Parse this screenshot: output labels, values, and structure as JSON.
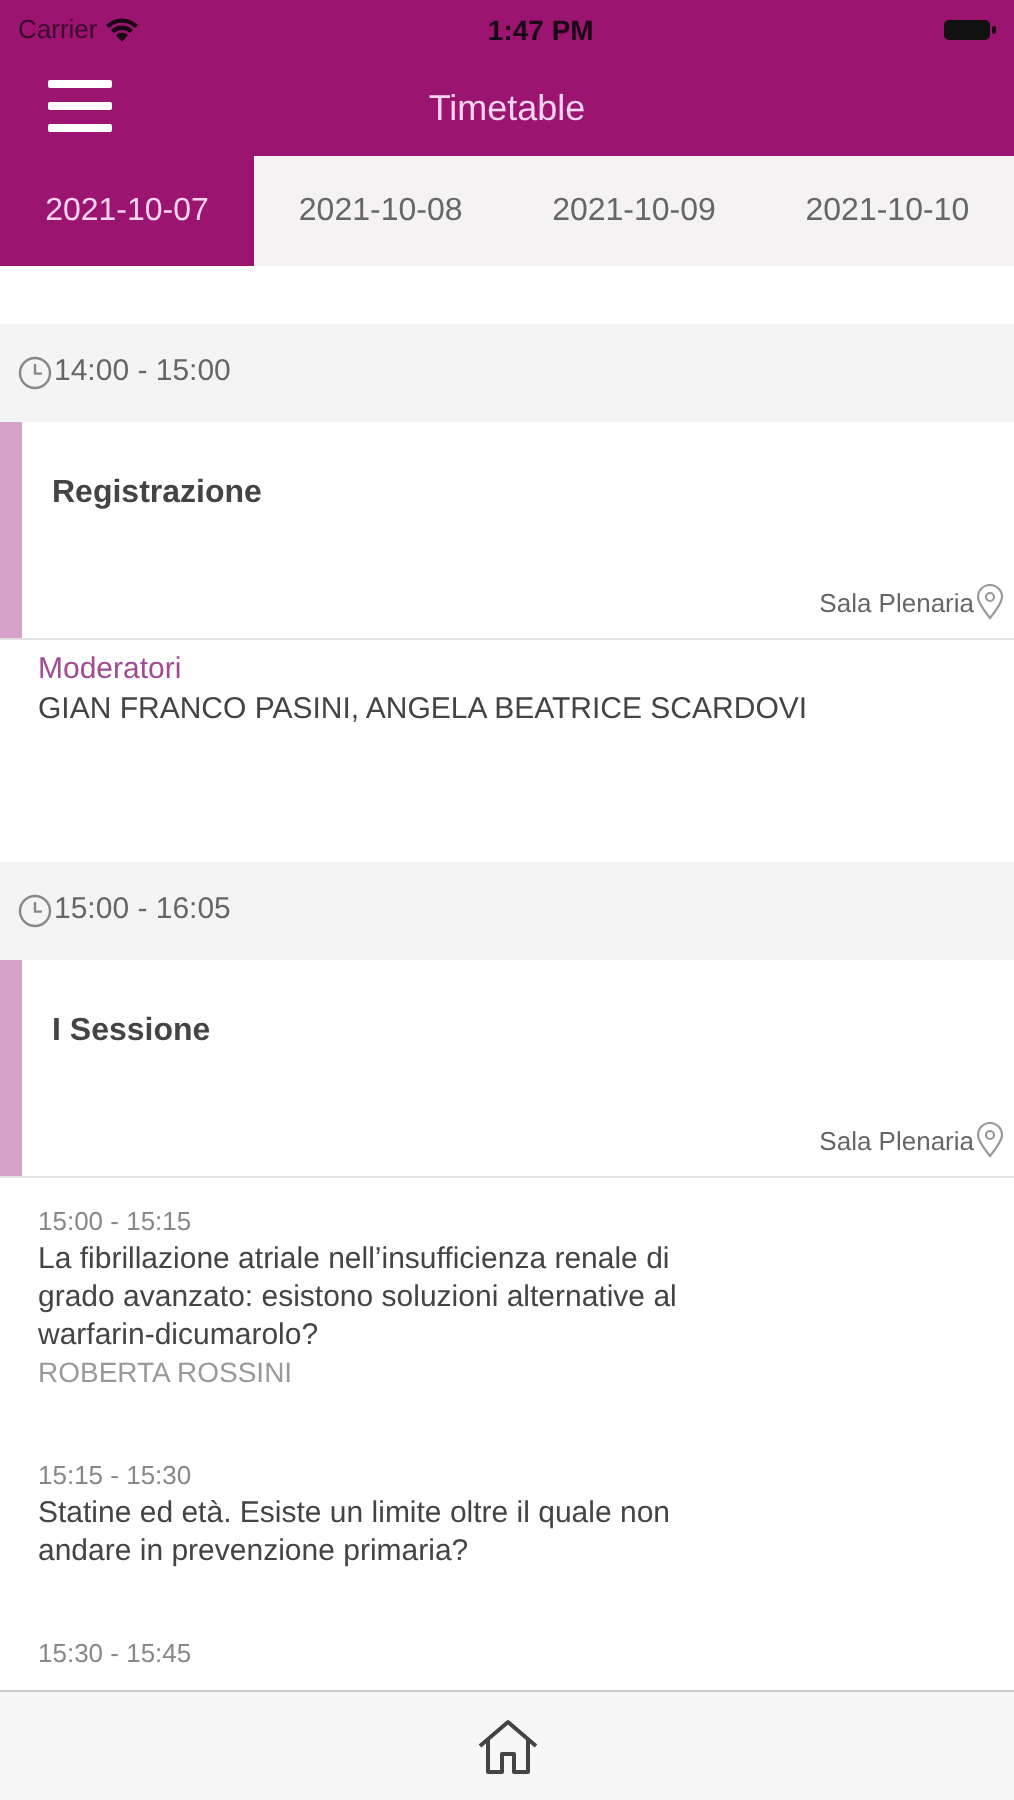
{
  "status_bar": {
    "carrier": "Carrier",
    "time": "1:47 PM"
  },
  "nav": {
    "title": "Timetable"
  },
  "tabs": [
    {
      "label": "2021-10-07",
      "selected": true
    },
    {
      "label": "2021-10-08",
      "selected": false
    },
    {
      "label": "2021-10-09",
      "selected": false
    },
    {
      "label": "2021-10-10",
      "selected": false
    }
  ],
  "sessions": [
    {
      "time": "14:00 - 15:00",
      "title": "Registrazione",
      "room": "Sala Plenaria",
      "items": [
        {
          "kind": "moderators",
          "label": "Moderatori",
          "text": "GIAN FRANCO PASINI, ANGELA BEATRICE SCARDOVI"
        }
      ]
    },
    {
      "time": "15:00 - 16:05",
      "title": "I Sessione",
      "room": "Sala Plenaria",
      "items": [
        {
          "kind": "talk",
          "time": "15:00 - 15:15",
          "text": "La fibrillazione atriale nell’insufficienza renale di grado avanzato: esistono soluzioni alternative al warfarin-dicumarolo?",
          "speaker": "ROBERTA ROSSINI"
        },
        {
          "kind": "talk",
          "time": "15:15 - 15:30",
          "text": "Statine ed età. Esiste un limite oltre il quale non andare in prevenzione primaria?"
        },
        {
          "kind": "talk",
          "time": "15:30 - 15:45"
        }
      ]
    }
  ]
}
